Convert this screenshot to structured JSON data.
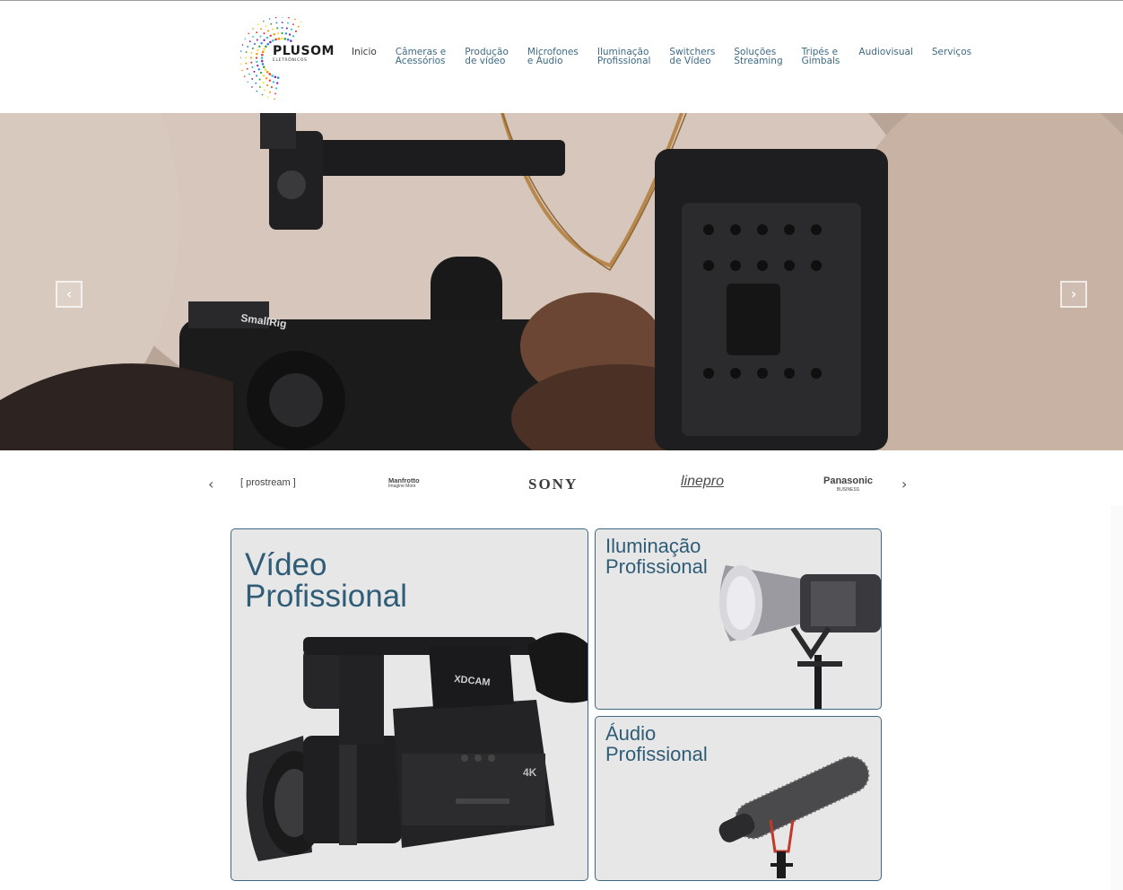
{
  "brand": {
    "name": "PLUSOM",
    "tagline": "ELETRÔNICOS"
  },
  "nav": [
    {
      "label": "Inicio"
    },
    {
      "label": "Câmeras e\nAcessórios"
    },
    {
      "label": "Produção\nde vídeo"
    },
    {
      "label": "Microfones\ne Áudio"
    },
    {
      "label": "Iluminação\nProfissional"
    },
    {
      "label": "Switchers\nde Vídeo"
    },
    {
      "label": "Soluções\nStreaming"
    },
    {
      "label": "Tripés e\nGimbals"
    },
    {
      "label": "Audiovisual"
    },
    {
      "label": "Serviços"
    }
  ],
  "hero": {
    "prev_label": "‹",
    "next_label": "›",
    "camera_rig_text": "SmallRig"
  },
  "brands": {
    "prev_label": "‹",
    "next_label": "›",
    "items": [
      {
        "name": "prostream"
      },
      {
        "name": "Manfrotto",
        "sub": "Imagine More"
      },
      {
        "name": "SONY"
      },
      {
        "name": "linepro"
      },
      {
        "name": "Panasonic",
        "sub": "BUSINESS"
      }
    ]
  },
  "categories": {
    "video": {
      "title": "Vídeo\nProfissional",
      "camera_text": "XDCAM",
      "camera_badge": "4K"
    },
    "lighting": {
      "title": "Iluminação\nProfissional"
    },
    "audio": {
      "title": "Áudio\nProfissional"
    }
  },
  "colors": {
    "accent": "#2f5d78",
    "card_border": "#3f6a82",
    "card_bg": "#e7e7e7",
    "nav_text": "#3d6a84"
  }
}
